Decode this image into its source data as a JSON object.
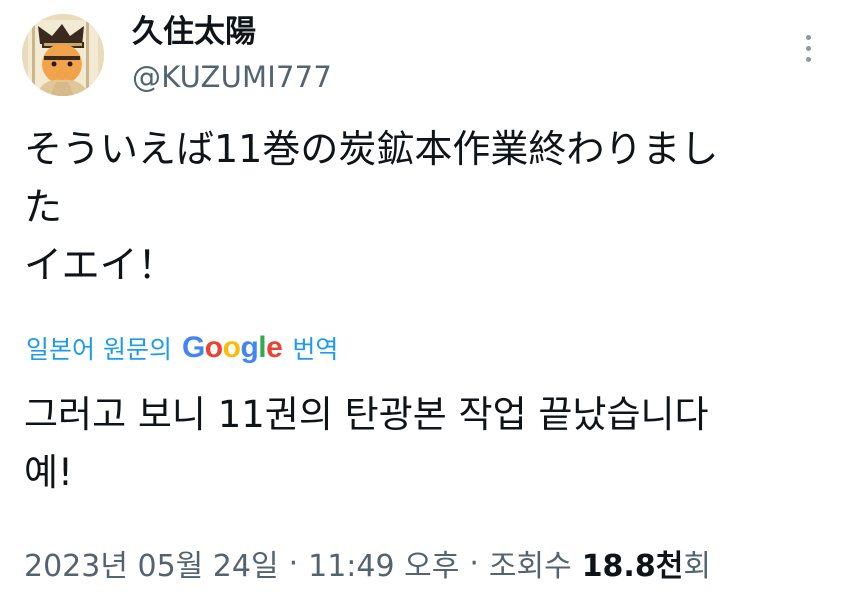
{
  "author": {
    "display_name": "久住太陽",
    "handle": "@KUZUMI777",
    "avatar_icon": "profile-avatar-illustration"
  },
  "menu": {
    "more_icon": "more-vertical-icon"
  },
  "tweet": {
    "text_lines": [
      "そういえば11巻の炭鉱本作業終わりまし",
      "た",
      "イエイ！"
    ]
  },
  "translation": {
    "prefix": "일본어 원문의",
    "logo_text": "Google",
    "action": "번역",
    "text_lines": [
      "그러고 보니 11권의 탄광본 작업 끝났습니다",
      "예!"
    ]
  },
  "meta": {
    "date": "2023년 05월 24일",
    "separator": "·",
    "time": "11:49 오후",
    "views_label": "조회수",
    "views_count": "18.8천",
    "views_unit": "회"
  },
  "colors": {
    "text": "#0f1419",
    "secondary": "#536471",
    "link": "#1d9bf0",
    "google_blue": "#4285F4",
    "google_red": "#EA4335",
    "google_yellow": "#FBBC05",
    "google_green": "#34A853"
  }
}
